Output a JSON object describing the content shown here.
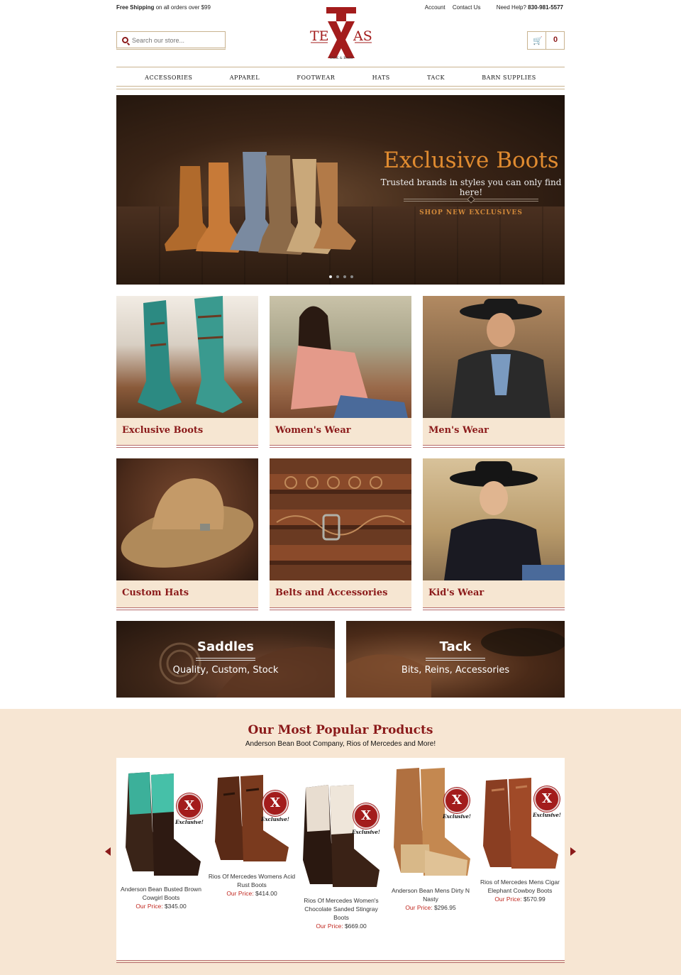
{
  "topbar": {
    "shipping_bold": "Free Shipping",
    "shipping_rest": "on all orders over $99",
    "account": "Account",
    "contact": "Contact Us",
    "help_label": "Need Help?",
    "phone": "830-981-5577"
  },
  "search": {
    "placeholder": "Search our store..."
  },
  "logo": {
    "top": "TE",
    "mid": "AS",
    "sub": "TACK & BAGS"
  },
  "cart": {
    "count": "0"
  },
  "nav": [
    "ACCESSORIES",
    "APPAREL",
    "FOOTWEAR",
    "HATS",
    "TACK",
    "BARN SUPPLIES"
  ],
  "hero": {
    "title": "Exclusive Boots",
    "subtitle": "Trusted brands in styles you can only find here!",
    "cta": "SHOP NEW EXCLUSIVES",
    "slides": 4,
    "active_slide": 1
  },
  "categories": [
    "Exclusive Boots",
    "Women's Wear",
    "Men's Wear",
    "Custom Hats",
    "Belts and Accessories",
    "Kid's Wear"
  ],
  "wide": [
    {
      "title": "Saddles",
      "subtitle": "Quality, Custom, Stock"
    },
    {
      "title": "Tack",
      "subtitle": "Bits, Reins, Accessories"
    }
  ],
  "popular": {
    "title": "Our Most Popular Products",
    "subtitle": "Anderson Bean Boot Company, Rios of Mercedes and More!",
    "badge": "Exclusive!",
    "price_label": "Our Price:",
    "products": [
      {
        "name": "Anderson Bean Busted Brown Cowgirl Boots",
        "price": "$345.00"
      },
      {
        "name": "Rios Of Mercedes Womens Acid Rust Boots",
        "price": "$414.00"
      },
      {
        "name": "Rios Of Mercedes Women's Chocolate Sanded Stingray Boots",
        "price": "$669.00"
      },
      {
        "name": "Anderson Bean Mens Dirty N Nasty",
        "price": "$296.95"
      },
      {
        "name": "Rios of Mercedes Mens Cigar Elephant Cowboy Boots",
        "price": "$570.99"
      }
    ]
  },
  "colors": {
    "brand": "#8b1a1a",
    "accent": "#e08b30",
    "cream": "#f7e6d3"
  }
}
